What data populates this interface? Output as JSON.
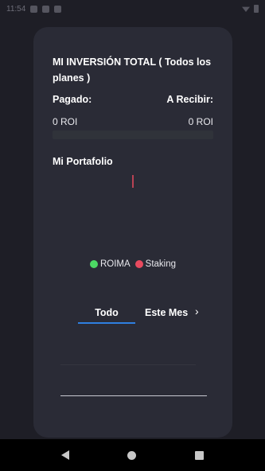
{
  "status_bar": {
    "time": "11:54",
    "icons": [
      "gear-icon",
      "notification-icon",
      "settings-icon"
    ],
    "right_icons": [
      "wifi-icon",
      "battery-icon"
    ]
  },
  "investment": {
    "title": "MI INVERSIÓN TOTAL ( Todos los planes )",
    "paid_label": "Pagado:",
    "receive_label": "A Recibir:",
    "paid_value": "0 ROI",
    "receive_value": "0 ROI",
    "progress_fraction": 0
  },
  "portfolio": {
    "title": "Mi Portafolio"
  },
  "chart_data": {
    "type": "pie",
    "categories": [
      "ROIMA",
      "Staking"
    ],
    "values": [
      0,
      0
    ],
    "colors": [
      "#4cd964",
      "#e84a5f"
    ],
    "legend_placement": "bottom"
  },
  "legend": {
    "items": [
      {
        "label": "ROIMA",
        "color": "#4cd964"
      },
      {
        "label": "Staking",
        "color": "#e84a5f"
      }
    ]
  },
  "tabs": {
    "todo": "Todo",
    "mes": "Este Mes",
    "next_icon": "chevron-right-icon"
  },
  "colors": {
    "background": "#1e1e26",
    "card": "#2a2b36",
    "accent": "#2f7fe0"
  },
  "nav": {
    "back_icon": "back-icon",
    "home_icon": "home-icon",
    "recents_icon": "recents-icon"
  }
}
